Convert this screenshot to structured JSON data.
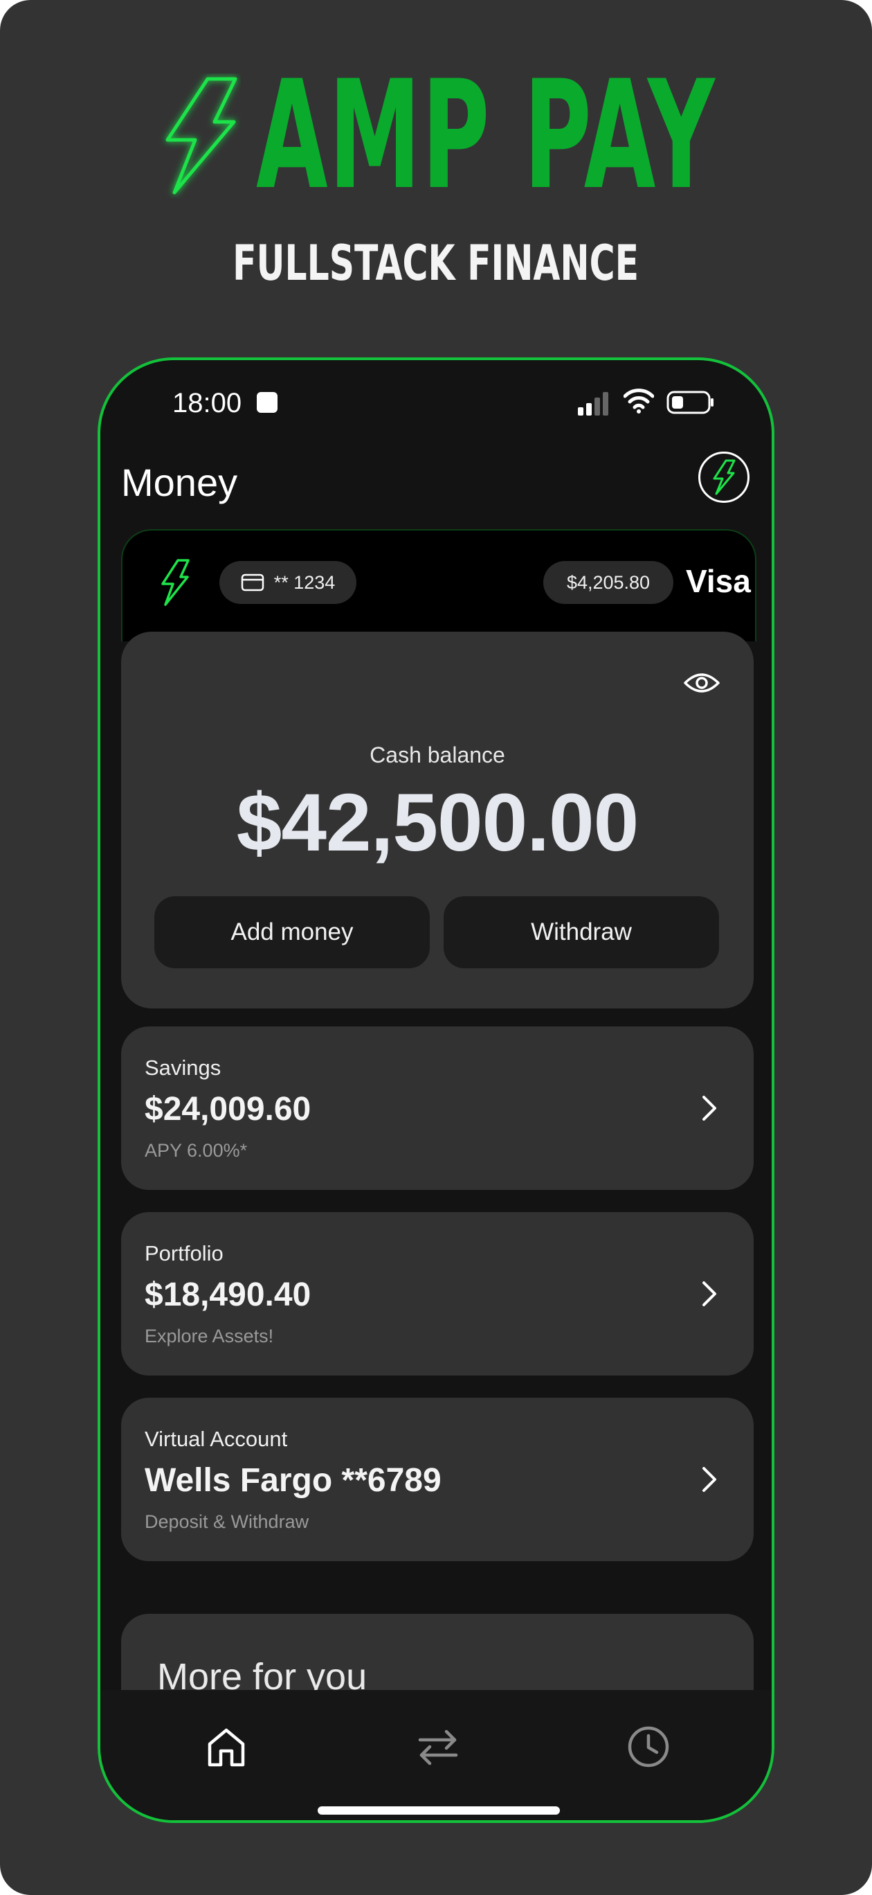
{
  "brand": {
    "name": "AMP PAY",
    "tagline": "FULLSTACK FINANCE",
    "accent_color": "#0aaa2d",
    "icon": "lightning-bolt-icon"
  },
  "status_bar": {
    "time": "18:00"
  },
  "header": {
    "title": "Money",
    "profile_icon": "lightning-bolt-icon"
  },
  "card": {
    "number": "** 1234",
    "balance": "$4,205.80",
    "network": "Visa"
  },
  "balance": {
    "label": "Cash balance",
    "value": "$42,500.00",
    "add_label": "Add money",
    "withdraw_label": "Withdraw"
  },
  "accounts": [
    {
      "label": "Savings",
      "value": "$24,009.60",
      "sub": "APY 6.00%*"
    },
    {
      "label": "Portfolio",
      "value": "$18,490.40",
      "sub": "Explore Assets!"
    },
    {
      "label": "Virtual Account",
      "value": "Wells Fargo **6789",
      "sub": "Deposit & Withdraw"
    }
  ],
  "more": {
    "title": "More for you"
  },
  "tab_bar": {
    "tabs": [
      "home-icon",
      "transfer-icon",
      "clock-icon"
    ],
    "active": "home-icon"
  }
}
